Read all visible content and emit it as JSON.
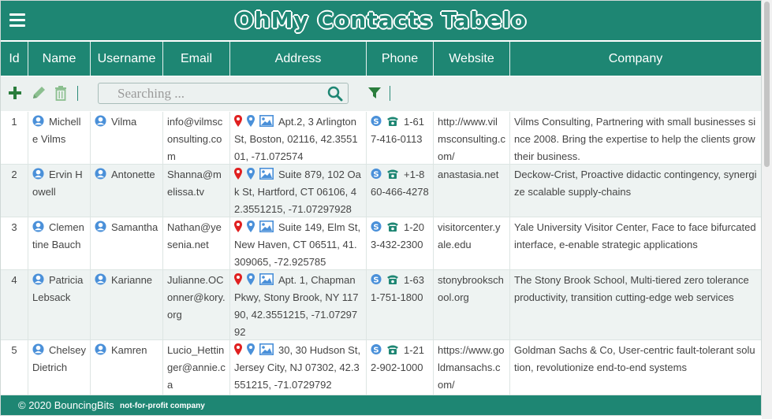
{
  "app": {
    "title": "OhMy Contacts Tabelo"
  },
  "columns": [
    "Id",
    "Name",
    "Username",
    "Email",
    "Address",
    "Phone",
    "Website",
    "Company"
  ],
  "toolbar": {
    "search_placeholder": "Searching ..."
  },
  "rows": [
    {
      "id": "1",
      "name": "Michelle Vilms",
      "username": "Vilma",
      "email": "info@vilmsconsulting.com",
      "address": "Apt.2, 3 Arlington St, Boston, 02116, 42.355101, -71.072574",
      "phone": "1-617-416-0113",
      "website": "http://www.vilmsconsulting.com/",
      "company": "Vilms Consulting, Partnering with small businesses since 2008. Bring the expertise to help the clients grow their business."
    },
    {
      "id": "2",
      "name": "Ervin Howell",
      "username": "Antonette",
      "email": "Shanna@melissa.tv",
      "address": "Suite 879, 102 Oak St, Hartford, CT 06106, 42.3551215, -71.07297928",
      "phone": "+1-860-466-4278",
      "website": "anastasia.net",
      "company": "Deckow-Crist, Proactive didactic contingency, synergize scalable supply-chains"
    },
    {
      "id": "3",
      "name": "Clementine Bauch",
      "username": "Samantha",
      "email": "Nathan@yesenia.net",
      "address": "Suite 149, Elm St, New Haven, CT 06511, 41.309065, -72.925785",
      "phone": "1-203-432-2300",
      "website": "visitorcenter.yale.edu",
      "company": "Yale University Visitor Center, Face to face bifurcated interface, e-enable strategic applications"
    },
    {
      "id": "4",
      "name": "Patricia Lebsack",
      "username": "Karianne",
      "email": "Julianne.OConner@kory.org",
      "address": "Apt. 1, Chapman Pkwy, Stony Brook, NY 11790, 42.3551215, -71.0729792",
      "phone": "1-631-751-1800",
      "website": "stonybrookschool.org",
      "company": "The Stony Brook School, Multi-tiered zero tolerance productivity, transition cutting-edge web services"
    },
    {
      "id": "5",
      "name": "Chelsey Dietrich",
      "username": "Kamren",
      "email": "Lucio_Hettinger@annie.ca",
      "address": "30, 30 Hudson St, Jersey City, NJ 07302, 42.3551215, -71.0729792",
      "phone": "1-212-902-1000",
      "website": "https://www.goldmansachs.com/",
      "company": "Goldman Sachs & Co, User-centric fault-tolerant solution, revolutionize end-to-end systems"
    }
  ],
  "footer": {
    "copyright": "© 2020 BouncingBits",
    "tagline": "not-for-profit company"
  },
  "colors": {
    "primary": "#1e8673",
    "row_alt": "#eef3f2",
    "map_pin": "#e02020",
    "icon_blue": "#4a90d9"
  },
  "icons": {
    "menu": "hamburger-icon",
    "add": "plus-icon",
    "edit": "pencil-icon",
    "delete": "trash-icon",
    "search": "magnifier-icon",
    "filter": "filter-icon",
    "user": "user-circle-icon",
    "map": "map-pin-icon",
    "location": "location-icon",
    "image": "image-icon",
    "skype": "skype-icon",
    "phone": "phone-icon"
  }
}
